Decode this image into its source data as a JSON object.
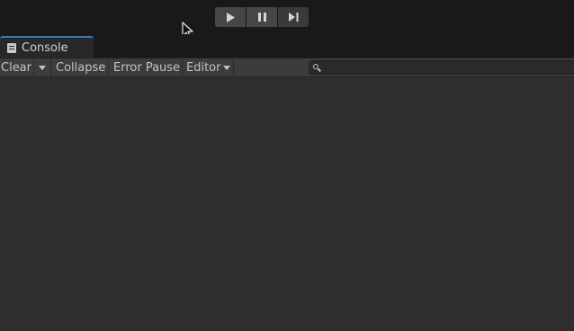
{
  "toolbar_play": {
    "play_icon": "play-icon",
    "pause_icon": "pause-icon",
    "step_icon": "step-icon"
  },
  "tab": {
    "label": "Console",
    "icon": "console-icon"
  },
  "toolbar": {
    "clear_label": "Clear",
    "collapse_label": "Collapse",
    "error_pause_label": "Error Pause",
    "editor_label": "Editor"
  },
  "search": {
    "value": "",
    "placeholder": ""
  },
  "colors": {
    "background": "#191919",
    "panel": "#2f2f2f",
    "toolbar": "#3c3c3c",
    "tab_accent": "#3a79bb"
  }
}
